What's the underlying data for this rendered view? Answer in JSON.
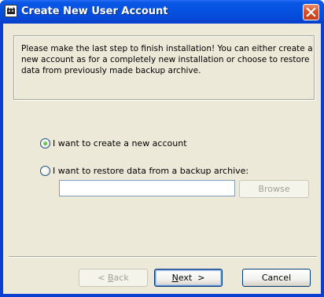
{
  "window": {
    "title": "Create New User Account"
  },
  "info": {
    "text": "Please make the last step to finish installation! You can either create a new account as for a completely new installation or choose to restore data from previously made backup archive."
  },
  "options": {
    "new_account": {
      "label": "I want to create a new account",
      "selected": true
    },
    "restore": {
      "label": "I want to restore data from a backup archive:",
      "selected": false
    }
  },
  "restore_path": {
    "value": "",
    "browse_label": "Browse",
    "browse_enabled": false
  },
  "buttons": {
    "back": {
      "prefix": "< ",
      "mnemonic": "B",
      "rest": "ack",
      "enabled": false
    },
    "next": {
      "mnemonic": "N",
      "rest": "ext  >",
      "enabled": true
    },
    "cancel": {
      "label": "Cancel",
      "enabled": true
    }
  }
}
